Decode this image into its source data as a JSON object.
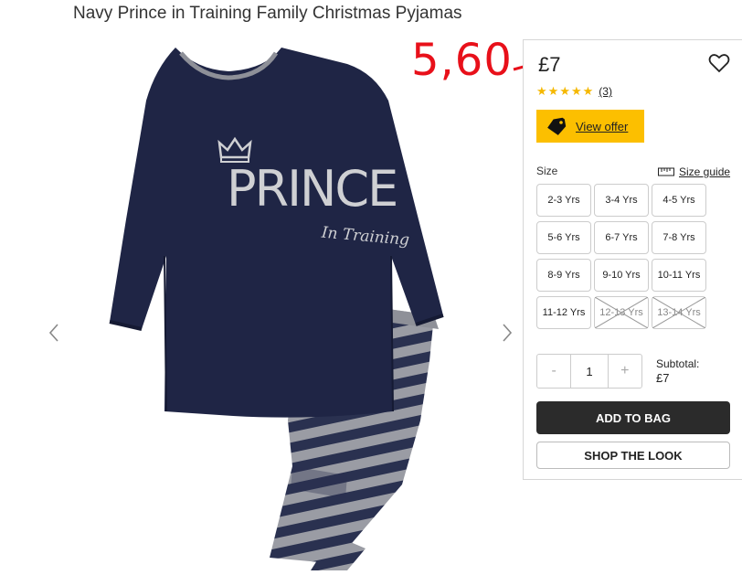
{
  "product": {
    "title": "Navy Prince in Training Family Christmas Pyjamas",
    "graphic_text_main": "PRINCE",
    "graphic_text_sub": "In Training"
  },
  "price": {
    "handwritten_sale": "5,60",
    "original": "£7"
  },
  "rating": {
    "stars": 5,
    "count_label": "(3)"
  },
  "offer": {
    "label": "View offer"
  },
  "size": {
    "label": "Size",
    "guide_label": "Size guide",
    "options": [
      {
        "label": "2-3 Yrs",
        "available": true
      },
      {
        "label": "3-4 Yrs",
        "available": true
      },
      {
        "label": "4-5 Yrs",
        "available": true
      },
      {
        "label": "5-6 Yrs",
        "available": true
      },
      {
        "label": "6-7 Yrs",
        "available": true
      },
      {
        "label": "7-8 Yrs",
        "available": true
      },
      {
        "label": "8-9 Yrs",
        "available": true
      },
      {
        "label": "9-10 Yrs",
        "available": true
      },
      {
        "label": "10-11 Yrs",
        "available": true
      },
      {
        "label": "11-12 Yrs",
        "available": true
      },
      {
        "label": "12-13 Yrs",
        "available": false
      },
      {
        "label": "13-14 Yrs",
        "available": false
      }
    ]
  },
  "quantity": {
    "minus": "-",
    "value": "1",
    "plus": "+"
  },
  "subtotal": {
    "label": "Subtotal:",
    "amount": "£7"
  },
  "actions": {
    "add_to_bag": "ADD TO BAG",
    "shop_the_look": "SHOP THE LOOK"
  },
  "icons": {
    "prev": "chevron-left-icon",
    "next": "chevron-right-icon",
    "wishlist": "heart-icon",
    "offer": "tag-icon",
    "size_guide": "ruler-icon"
  },
  "colors": {
    "accent_yellow": "#fcbf00",
    "star": "#f5b800",
    "sale_red": "#e8101a",
    "navy": "#1a2140",
    "button_dark": "#2b2b2b"
  }
}
